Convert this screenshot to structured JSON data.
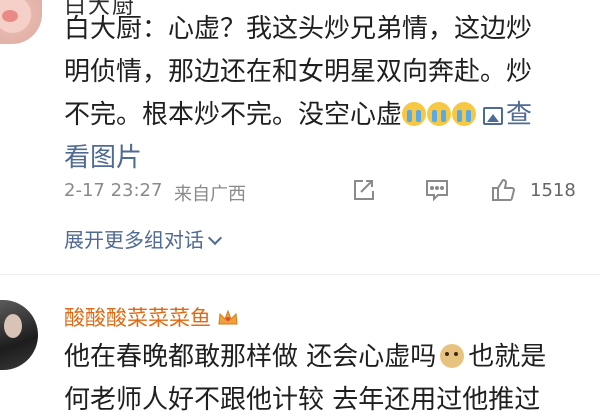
{
  "comment1": {
    "author_partial": "白大厨",
    "text_lines": [
      "白大厨：心虚？我这头炒兄弟情，这边炒",
      "明侦情，那边还在和女明星双向奔赴。炒",
      "不完。根本炒不完。没空心虚"
    ],
    "emoji_names": [
      "crying-emoji",
      "crying-emoji",
      "crying-emoji"
    ],
    "image_link_line3": "查",
    "image_link_line4": "看图片",
    "time": "2-17 23:27",
    "source": "来自广西",
    "like_count": "1518",
    "expand_label": "展开更多组对话"
  },
  "comment2": {
    "author": "酸酸酸菜菜菜鱼",
    "badge": "crown-icon",
    "line1_a": "他在春晚都敢那样做 还会心虚吗",
    "line1_b": "也就是",
    "line2": "何老师人好不跟他计较 去年还用过他推过"
  },
  "colors": {
    "link": "#506a96",
    "author2": "#e06a14",
    "meta": "#8a8a8a",
    "text": "#1f1f1f"
  }
}
